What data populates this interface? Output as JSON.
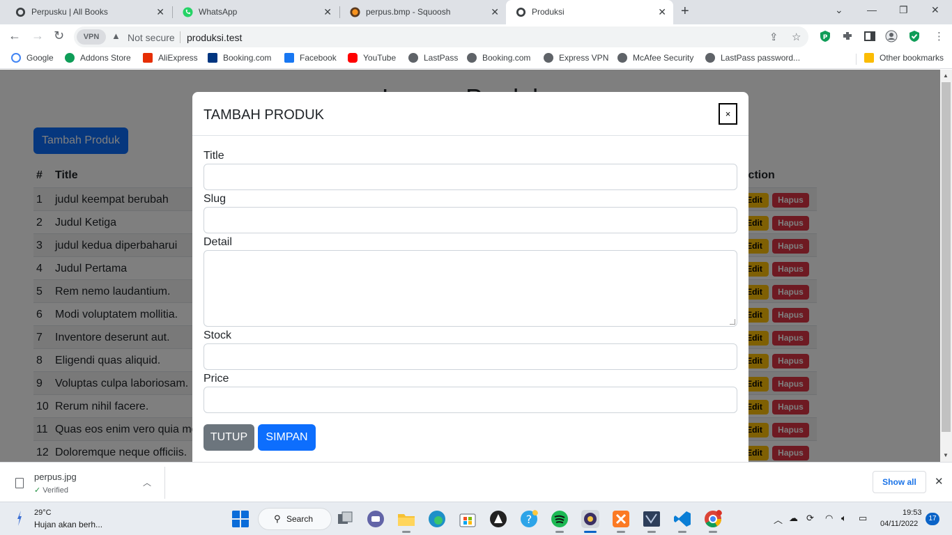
{
  "browser": {
    "tabs": [
      {
        "title": "Perpusku | All Books",
        "active": false
      },
      {
        "title": "WhatsApp",
        "active": false
      },
      {
        "title": "perpus.bmp - Squoosh",
        "active": false
      },
      {
        "title": "Produksi",
        "active": true
      }
    ],
    "new_tab": "+",
    "security": "Not secure",
    "url": "produksi.test",
    "vpn_label": "VPN",
    "bookmarks": [
      "Google",
      "Addons Store",
      "AliExpress",
      "Booking.com",
      "Facebook",
      "YouTube",
      "LastPass",
      "Booking.com",
      "Express VPN",
      "McAfee Security",
      "LastPass password..."
    ],
    "other_bookmarks": "Other bookmarks"
  },
  "page": {
    "heading": "Laman Produk",
    "add_button": "Tambah Produk",
    "table": {
      "headers": [
        "#",
        "Title",
        "Action"
      ],
      "rows": [
        {
          "no": "1",
          "title": "judul keempat berubah"
        },
        {
          "no": "2",
          "title": "Judul Ketiga"
        },
        {
          "no": "3",
          "title": "judul kedua diperbaharui"
        },
        {
          "no": "4",
          "title": "Judul Pertama"
        },
        {
          "no": "5",
          "title": "Rem nemo laudantium."
        },
        {
          "no": "6",
          "title": "Modi voluptatem mollitia."
        },
        {
          "no": "7",
          "title": "Inventore deserunt aut."
        },
        {
          "no": "8",
          "title": "Eligendi quas aliquid."
        },
        {
          "no": "9",
          "title": "Voluptas culpa laboriosam."
        },
        {
          "no": "10",
          "title": "Rerum nihil facere."
        },
        {
          "no": "11",
          "title": "Quas eos enim vero quia mo"
        },
        {
          "no": "12",
          "title": "Doloremque neque officiis."
        }
      ],
      "edit_label": "Edit",
      "delete_label": "Hapus"
    }
  },
  "modal": {
    "title": "TAMBAH PRODUK",
    "close": "×",
    "fields": {
      "title": {
        "label": "Title",
        "value": ""
      },
      "slug": {
        "label": "Slug",
        "value": ""
      },
      "detail": {
        "label": "Detail",
        "value": ""
      },
      "stock": {
        "label": "Stock",
        "value": ""
      },
      "price": {
        "label": "Price",
        "value": ""
      }
    },
    "close_button": "TUTUP",
    "save_button": "SIMPAN"
  },
  "download": {
    "filename": "perpus.jpg",
    "status": "Verified",
    "show_all": "Show all"
  },
  "taskbar": {
    "temperature": "29°C",
    "forecast": "Hujan akan berh...",
    "search": "Search",
    "time": "19:53",
    "date": "04/11/2022",
    "notifications": "17"
  }
}
